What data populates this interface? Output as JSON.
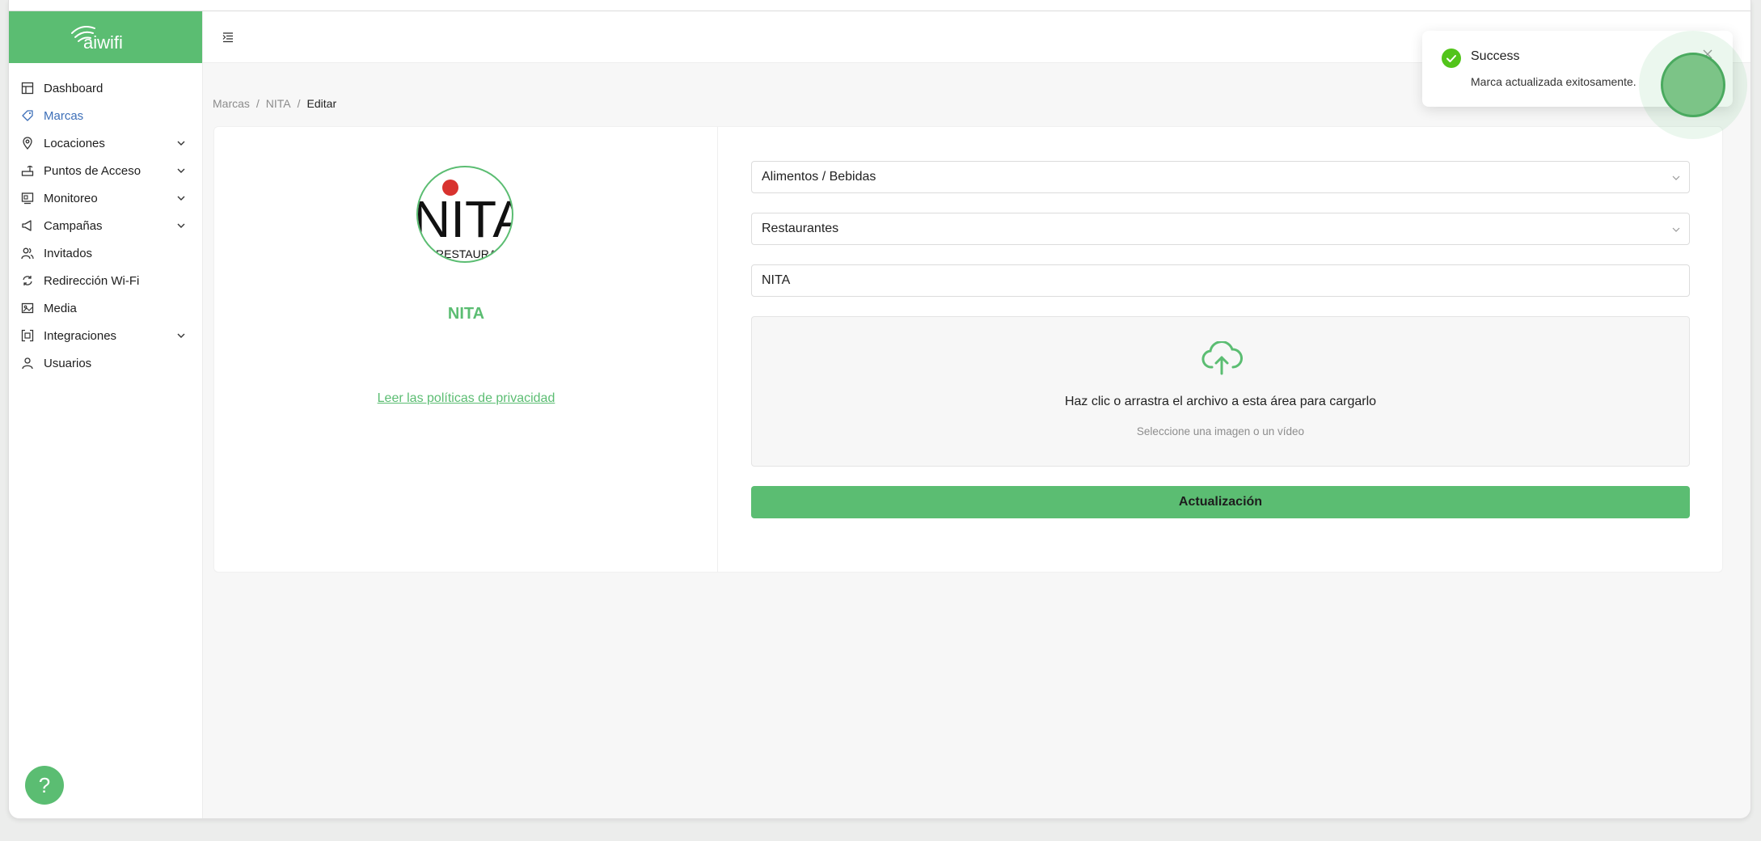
{
  "app": {
    "logo_text": "aiwifi",
    "brand_color": "#5bbd72",
    "link_color": "#3d6fb8"
  },
  "sidebar": {
    "items": [
      {
        "label": "Dashboard",
        "icon": "dashboard-icon",
        "expandable": false,
        "active": false
      },
      {
        "label": "Marcas",
        "icon": "tag-icon",
        "expandable": false,
        "active": true
      },
      {
        "label": "Locaciones",
        "icon": "location-pin-icon",
        "expandable": true,
        "active": false
      },
      {
        "label": "Puntos de Acceso",
        "icon": "router-icon",
        "expandable": true,
        "active": false
      },
      {
        "label": "Monitoreo",
        "icon": "monitor-icon",
        "expandable": true,
        "active": false
      },
      {
        "label": "Campañas",
        "icon": "megaphone-icon",
        "expandable": true,
        "active": false
      },
      {
        "label": "Invitados",
        "icon": "guests-icon",
        "expandable": false,
        "active": false
      },
      {
        "label": "Redirección Wi-Fi",
        "icon": "redirect-icon",
        "expandable": false,
        "active": false
      },
      {
        "label": "Media",
        "icon": "media-icon",
        "expandable": false,
        "active": false
      },
      {
        "label": "Integraciones",
        "icon": "integrations-icon",
        "expandable": true,
        "active": false
      },
      {
        "label": "Usuarios",
        "icon": "user-icon",
        "expandable": false,
        "active": false
      }
    ],
    "help_label": "?"
  },
  "breadcrumb": {
    "items": [
      "Marcas",
      "NITA"
    ],
    "current": "Editar",
    "separator": "/"
  },
  "brand": {
    "logo_text": "NITA",
    "logo_subtext": "RESTAURANT",
    "name": "NITA",
    "privacy_link": "Leer las políticas de privacidad"
  },
  "form": {
    "category": "Alimentos / Bebidas",
    "subcategory": "Restaurantes",
    "name_value": "NITA",
    "upload": {
      "title": "Haz clic o arrastra el archivo a esta área para cargarlo",
      "hint": "Seleccione una imagen o un vídeo"
    },
    "submit_label": "Actualización"
  },
  "toast": {
    "title": "Success",
    "message": "Marca actualizada exitosamente.",
    "status_color": "#52c41a"
  }
}
